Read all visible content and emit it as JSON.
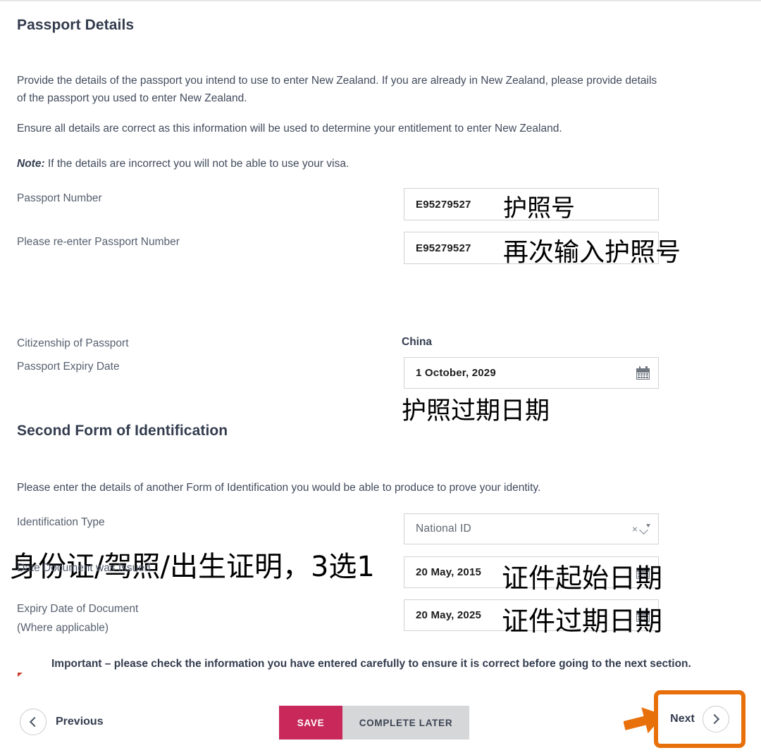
{
  "page": {
    "heading": "Passport Details",
    "intro_paragraph_1": "Provide the details of the passport you intend to use to enter New Zealand. If you are already in New Zealand, please provide details of the passport you used to enter New Zealand.",
    "intro_paragraph_2": "Ensure all details are correct as this information will be used to determine your entitlement to enter New Zealand.",
    "note_label": "Note:",
    "note_text": " If the details are incorrect you will not be able to use your visa."
  },
  "passport": {
    "number_label": "Passport Number",
    "number_value": "E95279527",
    "reenter_label": "Please re-enter Passport Number",
    "reenter_value": "E95279527",
    "citizenship_label": "Citizenship of Passport",
    "citizenship_value": "China",
    "expiry_label": "Passport Expiry Date",
    "expiry_value": "1 October, 2029"
  },
  "second_id": {
    "heading": "Second Form of Identification",
    "intro": "Please enter the details of another Form of Identification you would be able to produce to prove your identity.",
    "type_label": "Identification Type",
    "type_value": "National ID",
    "issued_label": "Date Document was Issued",
    "issued_value": "20 May, 2015",
    "expiry_label_line1": "Expiry Date of Document",
    "expiry_label_line2": "(Where applicable)",
    "expiry_value": "20 May, 2025"
  },
  "annotations": {
    "passport_number": "护照号",
    "reenter_passport_number": "再次输入护照号",
    "passport_expiry": "护照过期日期",
    "id_type": "身份证/驾照/出生证明，3选1",
    "issue_date": "证件起始日期",
    "doc_expiry_date": "证件过期日期"
  },
  "notice": {
    "text": "Important – please check the information you have entered carefully to ensure it is correct before going to the next section."
  },
  "footer": {
    "previous_label": "Previous",
    "save_label": "SAVE",
    "complete_later_label": "COMPLETE LATER",
    "next_label": "Next"
  },
  "colors": {
    "heading": "#333c4e",
    "body": "#414b5c",
    "save_button": "#c8285a",
    "complete_later_button": "#d6d7d9",
    "highlight_orange": "#e8700a",
    "notice_icon": "#c8402c",
    "input_border": "#cfd2d6"
  }
}
